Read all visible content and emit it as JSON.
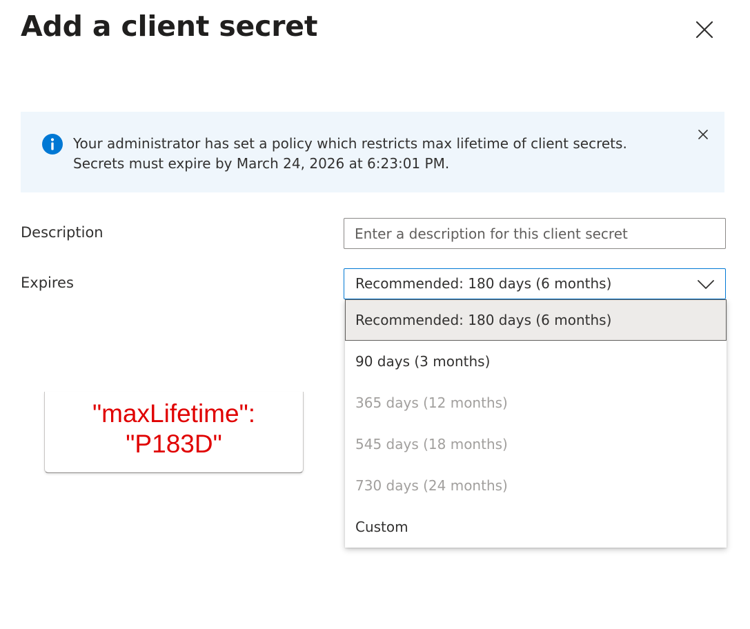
{
  "dialog": {
    "title": "Add a client secret",
    "close_icon": "close-icon"
  },
  "banner": {
    "icon": "info-icon",
    "text": "Your administrator has set a policy which restricts max lifetime of client secrets. Secrets must expire by March 24, 2026 at 6:23:01 PM.",
    "dismiss_icon": "close-icon"
  },
  "form": {
    "description": {
      "label": "Description",
      "value": "",
      "placeholder": "Enter a description for this client secret"
    },
    "expires": {
      "label": "Expires",
      "selected": "Recommended: 180 days (6 months)",
      "chevron_icon": "chevron-down-icon",
      "options": [
        {
          "label": "Recommended: 180 days (6 months)",
          "state": "selected"
        },
        {
          "label": "90 days (3 months)",
          "state": "enabled"
        },
        {
          "label": "365 days (12 months)",
          "state": "disabled"
        },
        {
          "label": "545 days (18 months)",
          "state": "disabled"
        },
        {
          "label": "730 days (24 months)",
          "state": "disabled"
        },
        {
          "label": "Custom",
          "state": "enabled"
        }
      ]
    }
  },
  "annotation": {
    "line1": "\"maxLifetime\":",
    "line2": "\"P183D\""
  },
  "colors": {
    "accent": "#0078d4",
    "banner_bg": "#eff6fc",
    "annotation_text": "#e00000",
    "disabled_text": "#a19f9d"
  }
}
